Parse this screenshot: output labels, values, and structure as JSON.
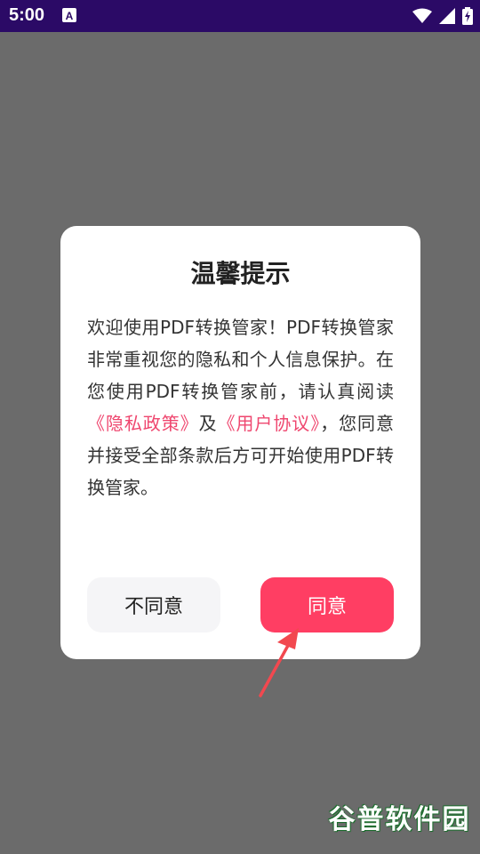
{
  "status_bar": {
    "time": "5:00",
    "app_icon_letter": "A"
  },
  "dialog": {
    "title": "温馨提示",
    "body": {
      "part1": "欢迎使用PDF转换管家！PDF转换管家非常重视您的隐私和个人信息保护。在您使用PDF转换管家前，请认真阅读",
      "privacy_link": "《隐私政策》",
      "connector": "及",
      "terms_link": "《用户协议》",
      "part2": "，您同意并接受全部条款后方可开始使用PDF转换管家。"
    },
    "disagree_label": "不同意",
    "agree_label": "同意"
  },
  "watermark": {
    "text": "谷普软件园"
  },
  "colors": {
    "status_bar": "#2b0a66",
    "overlay": "#6b6b6b",
    "accent": "#ff3e63",
    "link": "#ef476f",
    "annotation_arrow": "#f2484f"
  }
}
